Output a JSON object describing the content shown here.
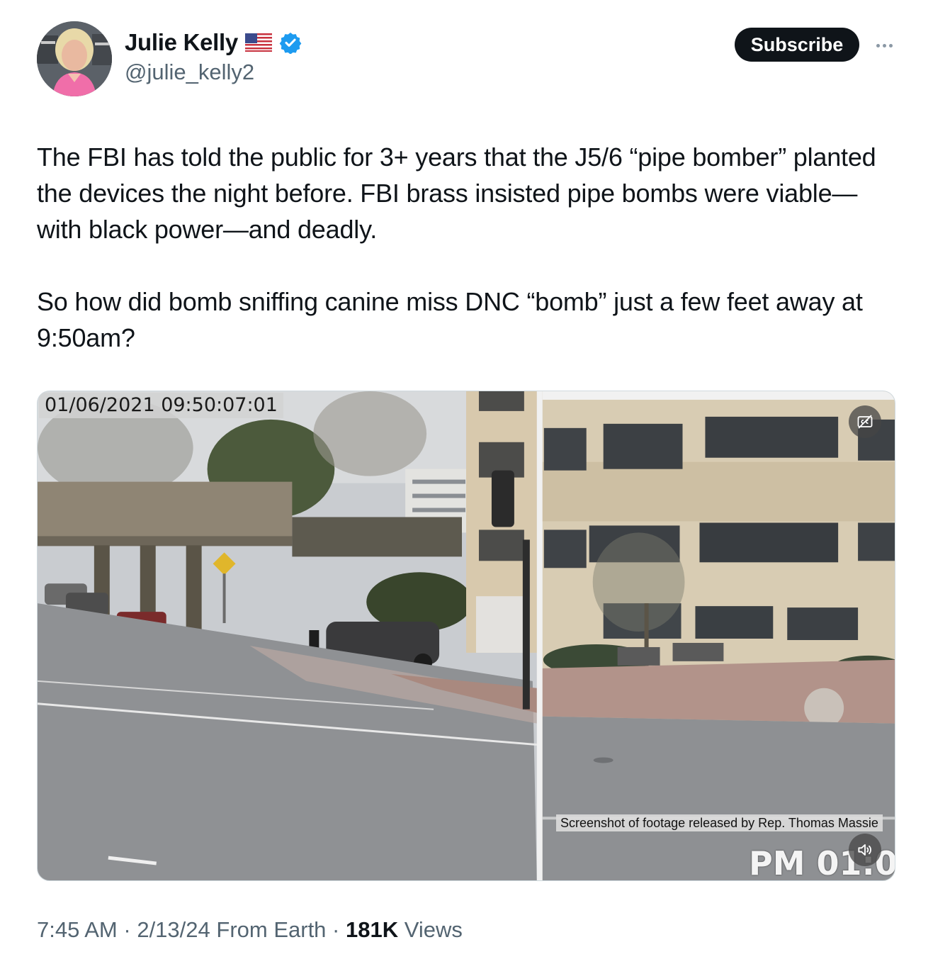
{
  "author": {
    "name": "Julie Kelly",
    "handle": "@julie_kelly2",
    "flag_icon": "us-flag-icon",
    "verified_icon": "verified-badge-icon"
  },
  "actions": {
    "subscribe_label": "Subscribe",
    "more_icon": "more-options-icon"
  },
  "tweet": {
    "paragraph_1": "The FBI has told the public for 3+ years that the J5/6 “pipe bomber” planted the devices the night before. FBI brass insisted pipe bombs were viable—with black power—and deadly.",
    "paragraph_2": "So how did bomb sniffing canine miss DNC “bomb” just a few feet away at 9:50am?"
  },
  "media": {
    "timestamp_overlay": "01/06/2021  09:50:07:01",
    "caption_overlay": "Screenshot of footage released by Rep. Thomas Massie",
    "pm_overlay": "PM 01:0",
    "cc_icon": "captions-off-icon",
    "sound_icon": "sound-icon"
  },
  "footer": {
    "time": "7:45 AM",
    "separator": "·",
    "date": "2/13/24",
    "location": "From Earth",
    "views_count": "181K",
    "views_label": "Views"
  },
  "colors": {
    "text": "#0f1419",
    "secondary_text": "#536471",
    "verified_blue": "#1d9bf0",
    "subscribe_bg": "#0f1419",
    "avatar_shirt": "#f06ea9"
  }
}
